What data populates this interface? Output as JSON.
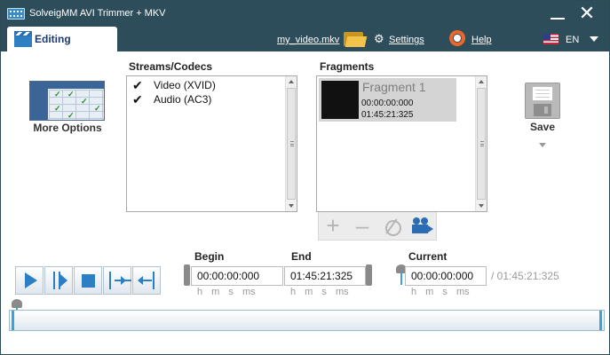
{
  "window": {
    "title": "SolveigMM AVI Trimmer + MKV",
    "minimize_label": "Minimize",
    "close_label": "Close",
    "close_glyph": "✕"
  },
  "tabbar": {
    "active_tab": "Editing",
    "file_name": "my_video.mkv",
    "settings_label": "Settings",
    "help_label": "Help",
    "language": "EN",
    "icons": [
      "clapperboard-icon",
      "folder-icon",
      "gear-icon",
      "help-ring-icon",
      "us-flag-icon",
      "chevron-down-icon"
    ]
  },
  "more_options": {
    "label": "More Options",
    "icon": "table-grid-icon"
  },
  "streams": {
    "heading": "Streams/Codecs",
    "items": [
      {
        "label": "Video (XVID)",
        "checked": true
      },
      {
        "label": "Audio (AC3)",
        "checked": true
      }
    ]
  },
  "fragments": {
    "heading": "Fragments",
    "items": [
      {
        "name": "Fragment 1",
        "start": "00:00:00:000",
        "end": "01:45:21:325"
      }
    ],
    "toolbar": [
      "plus-icon",
      "minus-icon",
      "clear-icon",
      "camera-icon"
    ]
  },
  "save": {
    "label": "Save",
    "icon": "floppy-disk-icon"
  },
  "playback": {
    "buttons": [
      "play-icon",
      "play-selection-icon",
      "stop-icon",
      "go-to-end-marker-icon",
      "go-to-start-marker-icon"
    ]
  },
  "timecodes": {
    "begin_label": "Begin",
    "begin_value": "00:00:00:000",
    "end_label": "End",
    "end_value": "01:45:21:325",
    "current_label": "Current",
    "current_value": "00:00:00:000",
    "total_display": "/ 01:45:21:325",
    "units": "h   m   s    ms"
  },
  "timeline": {
    "position_fraction": 0.0
  },
  "colors": {
    "titlebar": "#2e4d5a",
    "accent_blue": "#2d7fc5",
    "marker_blue": "#3aa3d9",
    "help_orange": "#e9672a"
  }
}
